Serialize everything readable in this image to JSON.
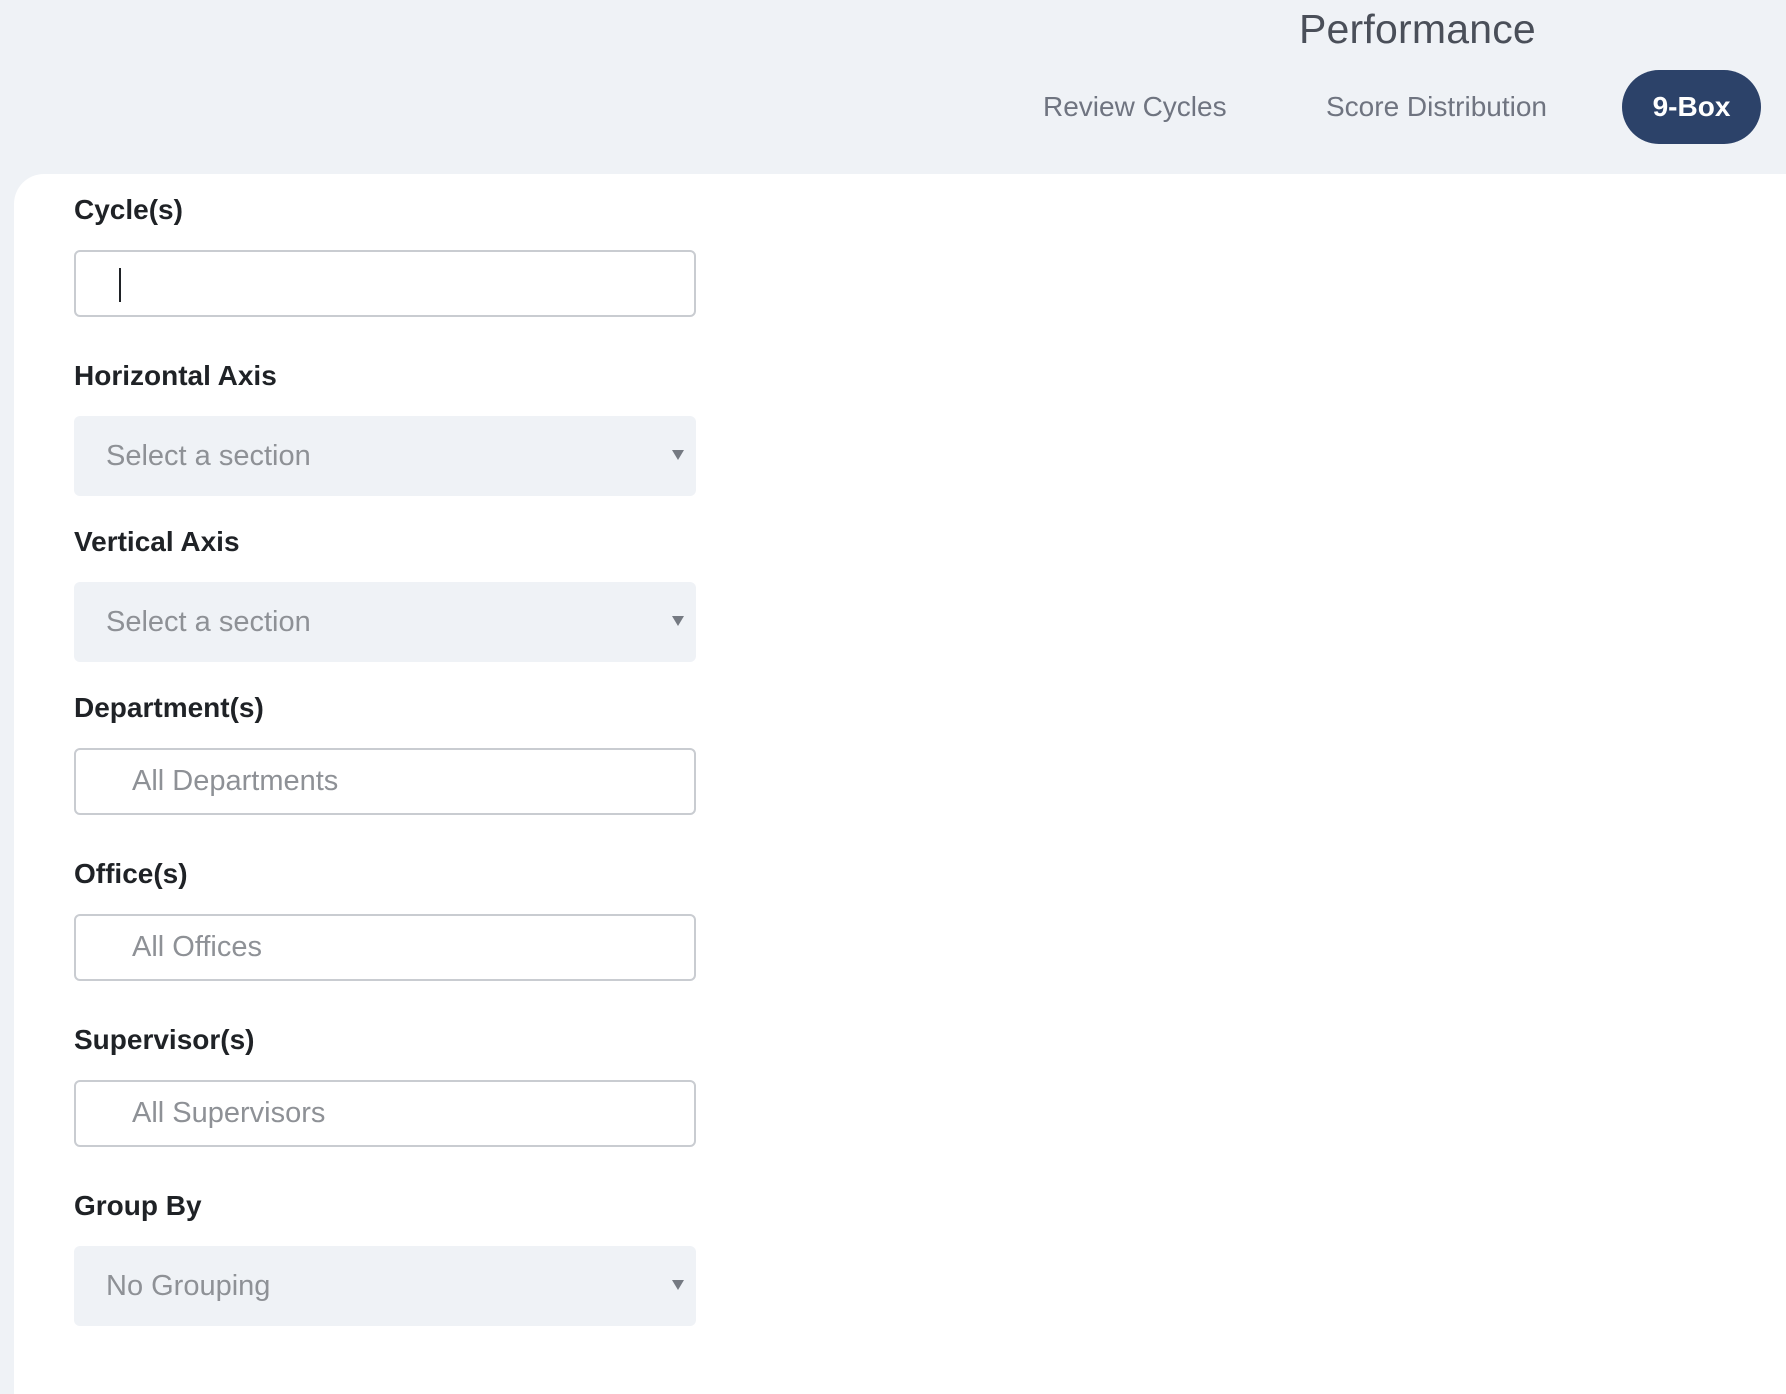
{
  "header": {
    "title": "Performance"
  },
  "tabs": [
    {
      "label": "Review Cycles",
      "active": false
    },
    {
      "label": "Score Distribution",
      "active": false
    },
    {
      "label": "9-Box",
      "active": true
    }
  ],
  "colors": {
    "active_tab_bg": "#2c4269",
    "page_bg": "#eff2f6",
    "panel_bg": "#ffffff"
  },
  "filters": {
    "cycles": {
      "label": "Cycle(s)",
      "value": ""
    },
    "horizontal_axis": {
      "label": "Horizontal Axis",
      "placeholder": "Select a section"
    },
    "vertical_axis": {
      "label": "Vertical Axis",
      "placeholder": "Select a section"
    },
    "departments": {
      "label": "Department(s)",
      "placeholder": "All Departments"
    },
    "offices": {
      "label": "Office(s)",
      "placeholder": "All Offices"
    },
    "supervisors": {
      "label": "Supervisor(s)",
      "placeholder": "All Supervisors"
    },
    "group_by": {
      "label": "Group By",
      "value": "No Grouping"
    }
  }
}
